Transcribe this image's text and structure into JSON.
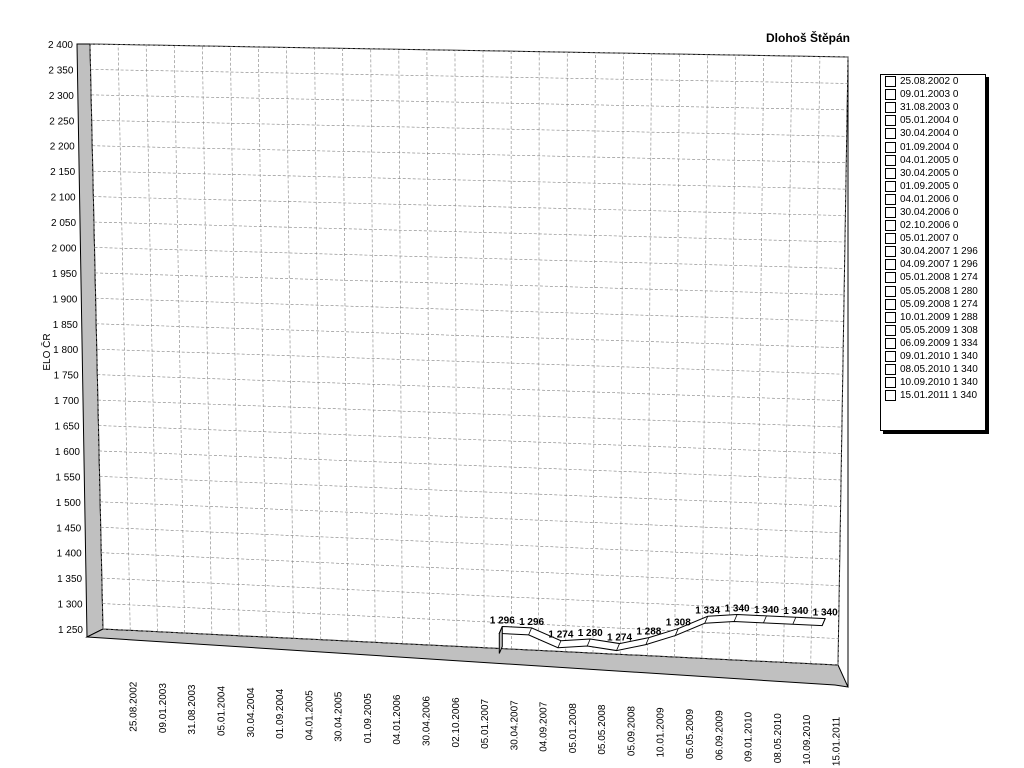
{
  "chart_data": {
    "type": "area",
    "title": "Dlohoš Štěpán",
    "ylabel": "ELO ČR",
    "xlabel": "",
    "ylim": [
      1250,
      2400
    ],
    "yticks": [
      1250,
      1300,
      1350,
      1400,
      1450,
      1500,
      1550,
      1600,
      1650,
      1700,
      1750,
      1800,
      1850,
      1900,
      1950,
      2000,
      2050,
      2100,
      2150,
      2200,
      2250,
      2300,
      2350,
      2400
    ],
    "ytick_labels": [
      "1 250",
      "1 300",
      "1 350",
      "1 400",
      "1 450",
      "1 500",
      "1 550",
      "1 600",
      "1 650",
      "1 700",
      "1 750",
      "1 800",
      "1 850",
      "1 900",
      "1 950",
      "2 000",
      "2 050",
      "2 100",
      "2 150",
      "2 200",
      "2 250",
      "2 300",
      "2 350",
      "2 400"
    ],
    "categories": [
      "25.08.2002",
      "09.01.2003",
      "31.08.2003",
      "05.01.2004",
      "30.04.2004",
      "01.09.2004",
      "04.01.2005",
      "30.04.2005",
      "01.09.2005",
      "04.01.2006",
      "30.04.2006",
      "02.10.2006",
      "05.01.2007",
      "30.04.2007",
      "04.09.2007",
      "05.01.2008",
      "05.05.2008",
      "05.09.2008",
      "10.01.2009",
      "05.05.2009",
      "06.09.2009",
      "09.01.2010",
      "08.05.2010",
      "10.09.2010",
      "15.01.2011"
    ],
    "values": [
      0,
      0,
      0,
      0,
      0,
      0,
      0,
      0,
      0,
      0,
      0,
      0,
      0,
      1296,
      1296,
      1274,
      1280,
      1274,
      1288,
      1308,
      1334,
      1340,
      1340,
      1340,
      1340
    ],
    "value_labels": [
      "",
      "",
      "",
      "",
      "",
      "",
      "",
      "",
      "",
      "",
      "",
      "",
      "",
      "1 296",
      "1 296",
      "1 274",
      "1 280",
      "1 274",
      "1 288",
      "1 308",
      "1 334",
      "1 340",
      "1 340",
      "1 340",
      "1 340"
    ],
    "grid": true,
    "legend_position": "right",
    "legend_entries": [
      "25.08.2002 0",
      "09.01.2003 0",
      "31.08.2003 0",
      "05.01.2004 0",
      "30.04.2004 0",
      "01.09.2004 0",
      "04.01.2005 0",
      "30.04.2005 0",
      "01.09.2005 0",
      "04.01.2006 0",
      "30.04.2006 0",
      "02.10.2006 0",
      "05.01.2007 0",
      "30.04.2007 1 296",
      "04.09.2007 1 296",
      "05.01.2008 1 274",
      "05.05.2008 1 280",
      "05.09.2008 1 274",
      "10.01.2009 1 288",
      "05.05.2009 1 308",
      "06.09.2009 1 334",
      "09.01.2010 1 340",
      "08.05.2010 1 340",
      "10.09.2010 1 340",
      "15.01.2011 1 340"
    ],
    "colors": {
      "background": "#ffffff",
      "wall": "#c0c0c0",
      "grid": "#808080",
      "line": "#000000",
      "series_fill": "#ffffff"
    }
  }
}
